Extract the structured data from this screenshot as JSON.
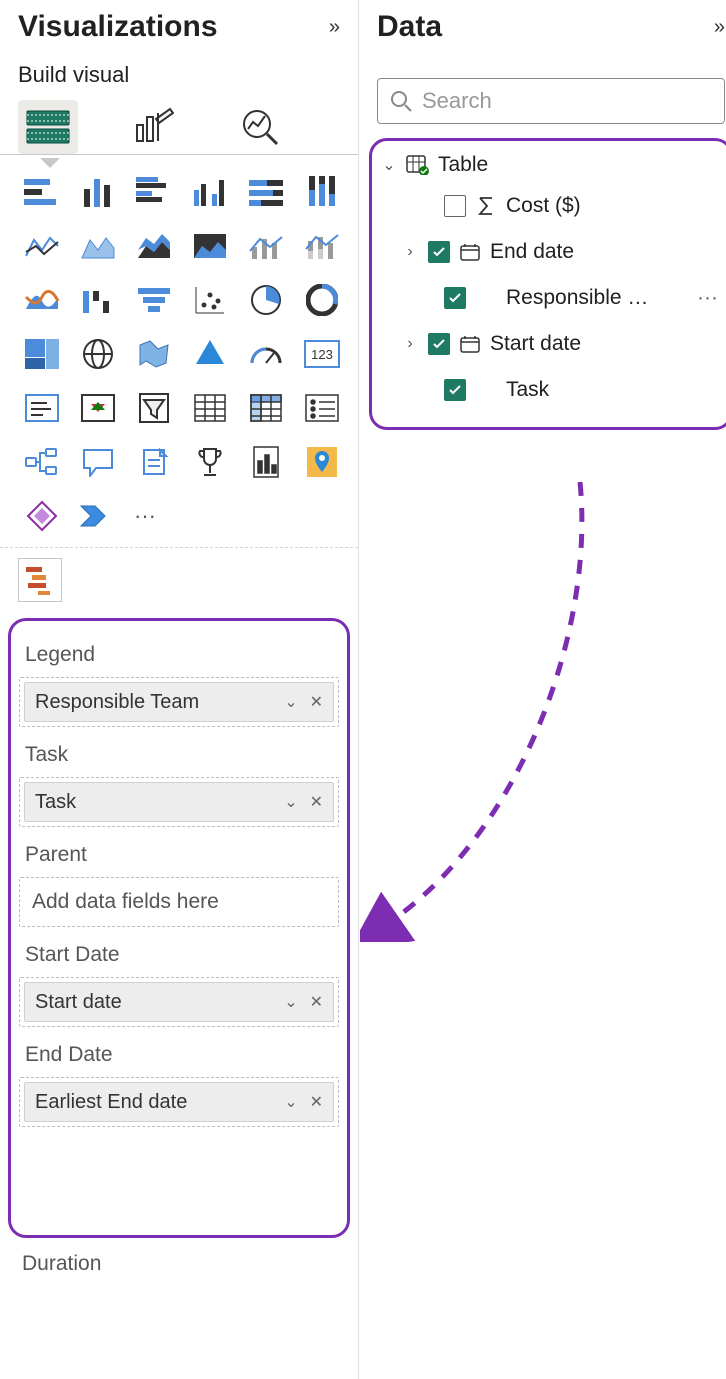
{
  "viz_panel": {
    "title": "Visualizations",
    "subtitle": "Build visual",
    "collapse_glyph": "»",
    "mode_tabs": [
      "build",
      "format",
      "analytics"
    ],
    "more_glyph": "···",
    "wells": {
      "legend": {
        "label": "Legend",
        "chip": "Responsible Team"
      },
      "task": {
        "label": "Task",
        "chip": "Task"
      },
      "parent": {
        "label": "Parent",
        "placeholder": "Add data fields here"
      },
      "start": {
        "label": "Start Date",
        "chip": "Start date"
      },
      "end": {
        "label": "End Date",
        "chip": "Earliest End date"
      },
      "duration": {
        "label": "Duration"
      }
    }
  },
  "data_panel": {
    "title": "Data",
    "collapse_glyph": "»",
    "search_placeholder": "Search",
    "table_name": "Table",
    "fields": [
      {
        "label": "Cost ($)",
        "checked": false,
        "type": "sum",
        "expandable": false
      },
      {
        "label": "End date",
        "checked": true,
        "type": "date",
        "expandable": true
      },
      {
        "label": "Responsible …",
        "checked": true,
        "type": "text",
        "expandable": false,
        "more": true
      },
      {
        "label": "Start date",
        "checked": true,
        "type": "date",
        "expandable": true
      },
      {
        "label": "Task",
        "checked": true,
        "type": "text",
        "expandable": false
      }
    ]
  },
  "colors": {
    "accent": "#7c2db2",
    "check": "#1f7a63"
  }
}
